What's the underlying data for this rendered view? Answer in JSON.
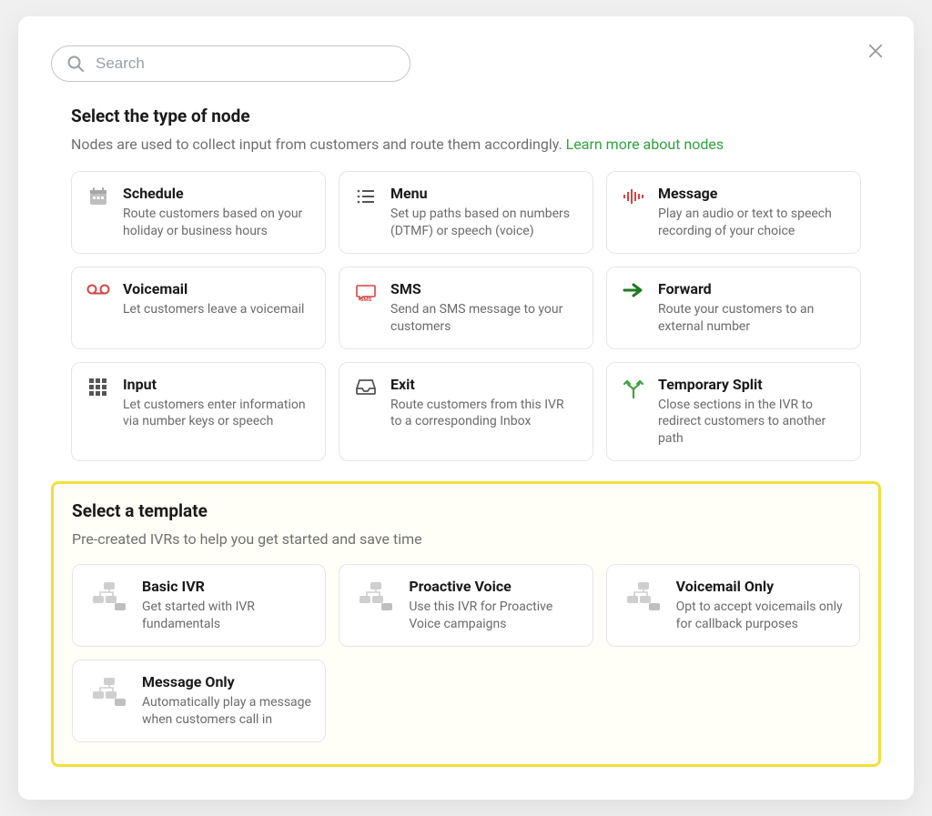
{
  "search": {
    "placeholder": "Search",
    "value": ""
  },
  "node_section": {
    "title": "Select the type of node",
    "subtitle_text": "Nodes are used to collect input from customers and route them accordingly. ",
    "learn_more": "Learn more about nodes",
    "cards": [
      {
        "icon": "calendar",
        "title": "Schedule",
        "desc": "Route customers based on your holiday or business hours"
      },
      {
        "icon": "menu",
        "title": "Menu",
        "desc": "Set up paths based on numbers (DTMF) or speech (voice)"
      },
      {
        "icon": "audio",
        "title": "Message",
        "desc": "Play an audio or text to speech recording of your choice"
      },
      {
        "icon": "voicemail",
        "title": "Voicemail",
        "desc": "Let customers leave a voicemail"
      },
      {
        "icon": "sms",
        "title": "SMS",
        "desc": "Send an SMS message to your customers"
      },
      {
        "icon": "forward",
        "title": "Forward",
        "desc": "Route your customers to an external number"
      },
      {
        "icon": "keypad",
        "title": "Input",
        "desc": "Let customers enter information via number keys or speech"
      },
      {
        "icon": "inbox",
        "title": "Exit",
        "desc": "Route customers from this IVR to a corresponding Inbox"
      },
      {
        "icon": "split",
        "title": "Temporary Split",
        "desc": "Close sections in the IVR to redirect customers to another path"
      }
    ]
  },
  "template_section": {
    "title": "Select a template",
    "subtitle": "Pre-created IVRs to help you get started and save time",
    "cards": [
      {
        "title": "Basic IVR",
        "desc": "Get started with IVR fundamentals"
      },
      {
        "title": "Proactive Voice",
        "desc": "Use this IVR for Proactive Voice campaigns"
      },
      {
        "title": "Voicemail Only",
        "desc": "Opt to accept voicemails only for callback purposes"
      },
      {
        "title": "Message Only",
        "desc": "Automatically play a message when customers call in"
      }
    ]
  }
}
